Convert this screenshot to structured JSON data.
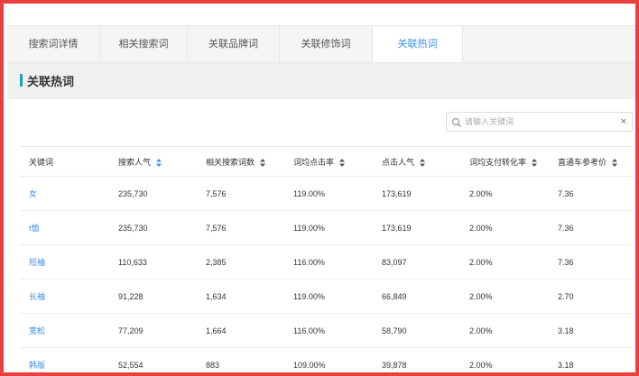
{
  "tabs": [
    {
      "label": "搜索词详情",
      "active": false
    },
    {
      "label": "相关搜索词",
      "active": false
    },
    {
      "label": "关联品牌词",
      "active": false
    },
    {
      "label": "关联修饰词",
      "active": false
    },
    {
      "label": "关联热词",
      "active": true
    }
  ],
  "section": {
    "title": "关联热词",
    "accent_color": "#17a2b8"
  },
  "search": {
    "placeholder": "请输入关键词",
    "value": "",
    "icon": "search-icon",
    "clear_label": "×"
  },
  "table": {
    "columns": [
      {
        "label": "关键词",
        "sortable": false
      },
      {
        "label": "搜索人气",
        "sortable": true,
        "active_sort": true
      },
      {
        "label": "相关搜索词数",
        "sortable": true
      },
      {
        "label": "词均点击率",
        "sortable": true
      },
      {
        "label": "点击人气",
        "sortable": true
      },
      {
        "label": "词均支付转化率",
        "sortable": true
      },
      {
        "label": "直通车参考价",
        "sortable": true
      }
    ],
    "rows": [
      [
        "女",
        "235,730",
        "7,576",
        "119.00%",
        "173,619",
        "2.00%",
        "7.36"
      ],
      [
        "t恤",
        "235,730",
        "7,576",
        "119.00%",
        "173,619",
        "2.00%",
        "7.36"
      ],
      [
        "短袖",
        "110,633",
        "2,385",
        "116.00%",
        "83,097",
        "2.00%",
        "7.36"
      ],
      [
        "长袖",
        "91,228",
        "1,634",
        "119.00%",
        "66,849",
        "2.00%",
        "2.70"
      ],
      [
        "宽松",
        "77,209",
        "1,664",
        "116.00%",
        "58,790",
        "2.00%",
        "3.18"
      ],
      [
        "韩版",
        "52,554",
        "883",
        "109.00%",
        "39,878",
        "2.00%",
        "3.18"
      ]
    ]
  },
  "colors": {
    "frame_border": "#e8403f",
    "link": "#3a8ee6",
    "active_sort": "#3a8ee6"
  }
}
